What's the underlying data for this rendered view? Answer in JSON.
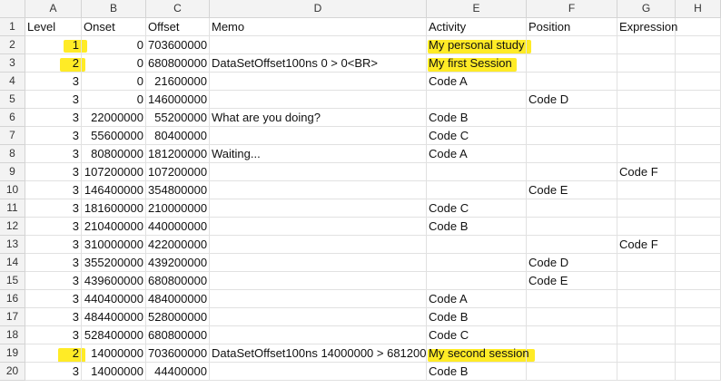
{
  "column_headers": [
    "A",
    "B",
    "C",
    "D",
    "E",
    "F",
    "G",
    "H"
  ],
  "row_numbers": [
    "1",
    "2",
    "3",
    "4",
    "5",
    "6",
    "7",
    "8",
    "9",
    "10",
    "11",
    "12",
    "13",
    "14",
    "15",
    "16",
    "17",
    "18",
    "19",
    "20"
  ],
  "rows": [
    [
      "Level",
      "Onset",
      "Offset",
      "Memo",
      "Activity",
      "Position",
      "Expression",
      ""
    ],
    [
      "1",
      "0",
      "703600000",
      "",
      "My personal study",
      "",
      "",
      ""
    ],
    [
      "2",
      "0",
      "680800000",
      "DataSetOffset100ns 0 > 0<BR>",
      "My first Session",
      "",
      "",
      ""
    ],
    [
      "3",
      "0",
      "21600000",
      "",
      "Code A",
      "",
      "",
      ""
    ],
    [
      "3",
      "0",
      "146000000",
      "",
      "",
      "Code D",
      "",
      ""
    ],
    [
      "3",
      "22000000",
      "55200000",
      "What are you doing?",
      "Code B",
      "",
      "",
      ""
    ],
    [
      "3",
      "55600000",
      "80400000",
      "",
      "Code C",
      "",
      "",
      ""
    ],
    [
      "3",
      "80800000",
      "181200000",
      "Waiting...",
      "Code A",
      "",
      "",
      ""
    ],
    [
      "3",
      "107200000",
      "107200000",
      "",
      "",
      "",
      "Code F",
      ""
    ],
    [
      "3",
      "146400000",
      "354800000",
      "",
      "",
      "Code E",
      "",
      ""
    ],
    [
      "3",
      "181600000",
      "210000000",
      "",
      "Code C",
      "",
      "",
      ""
    ],
    [
      "3",
      "210400000",
      "440000000",
      "",
      "Code B",
      "",
      "",
      ""
    ],
    [
      "3",
      "310000000",
      "422000000",
      "",
      "",
      "",
      "Code F",
      ""
    ],
    [
      "3",
      "355200000",
      "439200000",
      "",
      "",
      "Code D",
      "",
      ""
    ],
    [
      "3",
      "439600000",
      "680800000",
      "",
      "",
      "Code E",
      "",
      ""
    ],
    [
      "3",
      "440400000",
      "484000000",
      "",
      "Code A",
      "",
      "",
      ""
    ],
    [
      "3",
      "484400000",
      "528000000",
      "",
      "Code B",
      "",
      "",
      ""
    ],
    [
      "3",
      "528400000",
      "680800000",
      "",
      "Code C",
      "",
      "",
      ""
    ],
    [
      "2",
      "14000000",
      "703600000",
      "DataSetOffset100ns 14000000 > 681200",
      "My second session",
      "",
      "",
      ""
    ],
    [
      "3",
      "14000000",
      "44400000",
      "",
      "Code B",
      "",
      "",
      ""
    ]
  ],
  "colors": {
    "highlight": "#fff200",
    "header_bg": "#f3f3f3",
    "grid": "#e1e1e1"
  }
}
